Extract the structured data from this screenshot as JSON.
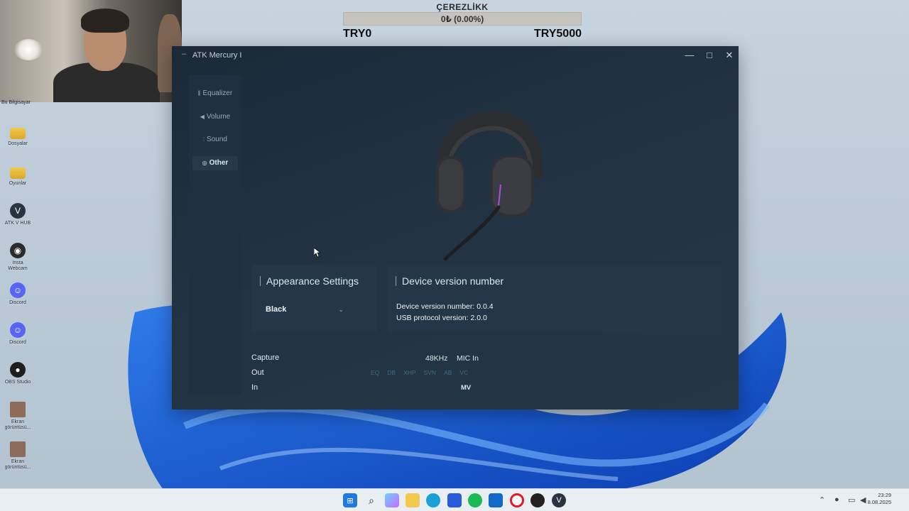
{
  "donation": {
    "title": "ÇEREZLİKK",
    "progress_text": "0₺ (0.00%)",
    "progress": 0,
    "min": "TRY0",
    "max": "TRY5000"
  },
  "desktop": {
    "top_label": "Bu Bilgisayar",
    "icons": [
      {
        "label": "Dosyalar",
        "icon": "folder-icon"
      },
      {
        "label": "Oyunlar",
        "icon": "folder-icon"
      },
      {
        "label": "ATK V HUB",
        "icon": "atk-app-icon"
      },
      {
        "label": "Insta Webcam",
        "icon": "webcam-app-icon"
      },
      {
        "label": "Discord",
        "icon": "discord-icon"
      },
      {
        "label": "Discord",
        "icon": "discord-icon"
      },
      {
        "label": "OBS Studio",
        "icon": "obs-icon"
      },
      {
        "label": "Ekran görüntüsü...",
        "icon": "screenshot-file-icon"
      },
      {
        "label": "Ekran görüntüsü...",
        "icon": "screenshot-file-icon"
      }
    ]
  },
  "window": {
    "title": "ATK Mercury I",
    "controls": {
      "minimize": "—",
      "maximize": "□",
      "close": "✕"
    }
  },
  "sidebar": {
    "items": [
      {
        "label": "Equalizer",
        "icon": "equalizer-icon"
      },
      {
        "label": "Volume",
        "icon": "volume-icon"
      },
      {
        "label": "Sound",
        "icon": "sound-icon"
      },
      {
        "label": "Other",
        "icon": "settings-icon",
        "active": true
      }
    ]
  },
  "appearance": {
    "title": "Appearance Settings",
    "selected": "Black"
  },
  "device": {
    "title": "Device version number",
    "device_version": "Device version number: 0.0.4",
    "usb_version": "USB protocol version: 2.0.0"
  },
  "status": {
    "capture_label": "Capture",
    "capture_rate": "48KHz",
    "capture_src": "MIC In",
    "out_label": "Out",
    "out_chips": [
      "EQ",
      "DB",
      "XHP",
      "SVN",
      "AB",
      "VC"
    ],
    "in_label": "In",
    "in_value": "MV"
  },
  "taskbar": {
    "time": "23:29",
    "date": "8.08.2025",
    "apps": [
      "start-icon",
      "search-icon",
      "copilot-icon",
      "file-explorer-icon",
      "edge-icon",
      "store-icon",
      "spotify-icon",
      "outlook-icon",
      "opera-icon",
      "obs-icon",
      "atk-app-icon"
    ]
  },
  "colors": {
    "window_bg": "#1f3040",
    "panel_bg": "#243748",
    "accent_text": "#dde5ec",
    "chip_dim": "#3f6b80"
  }
}
